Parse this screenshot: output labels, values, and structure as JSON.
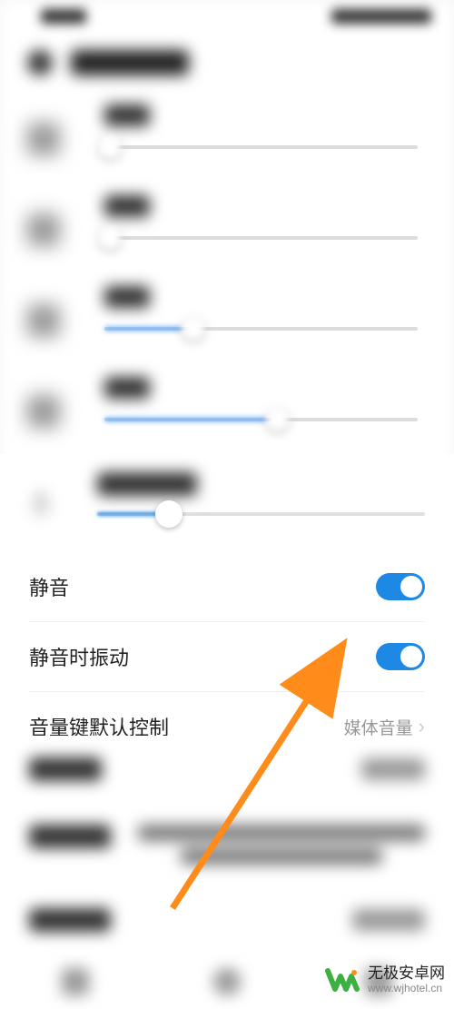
{
  "header": {
    "title": "声音和振动"
  },
  "sliders": {
    "media": {
      "label": "媒体",
      "value": 0
    },
    "ringtone": {
      "label": "铃声",
      "value": 0
    },
    "alarm": {
      "label": "闹钟",
      "value": 25
    },
    "call": {
      "label": "通话",
      "value": 50
    },
    "assistant": {
      "label": "智慧语音",
      "value": 22
    }
  },
  "settings": {
    "mute": {
      "label": "静音",
      "on": true
    },
    "vibrate_on_mute": {
      "label": "静音时振动",
      "on": true
    },
    "volume_key": {
      "label": "音量键默认控制",
      "value": "媒体音量"
    }
  },
  "blurred_items": {
    "default_ringtone": "默认铃声",
    "incoming_ringtone": "来电铃声",
    "message_ringtone": "信息铃声"
  },
  "watermark": {
    "title": "无极安卓网",
    "url": "www.wjhotel.cn"
  }
}
